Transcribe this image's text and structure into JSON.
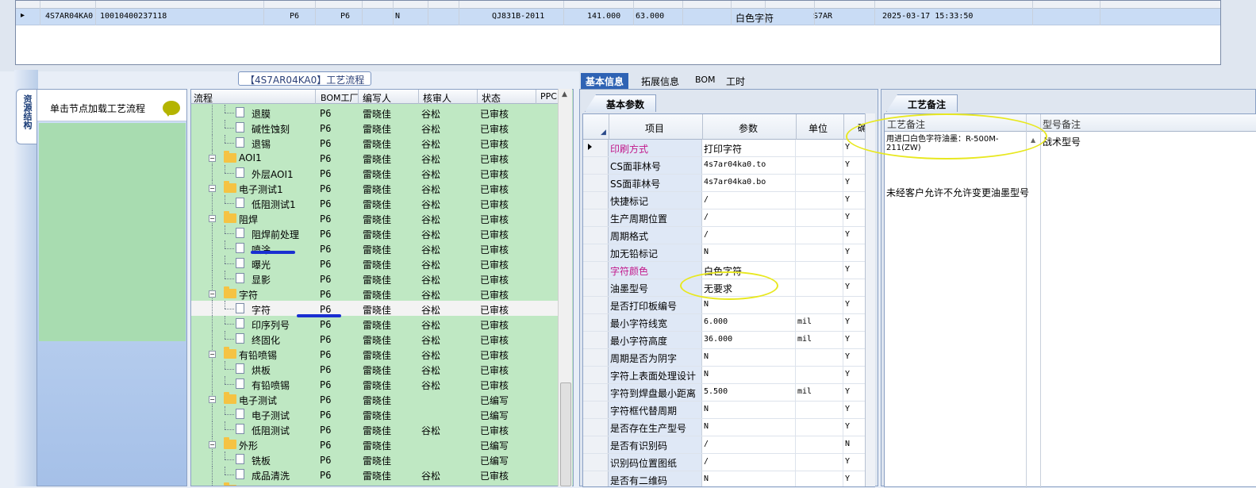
{
  "top_grid": {
    "row": {
      "code": "4S7AR04KA0",
      "id": "10010400237118",
      "f1": "P6",
      "f2": "P6",
      "f3": "N",
      "spec": "QJ831B-2011",
      "v1": "141.000",
      "v2": "63.000",
      "color": "白色字符",
      "model": "S7AR",
      "time": "2025-03-17 15:33:50"
    }
  },
  "side": {
    "tab_label": "资源结构",
    "hint": "单击节点加载工艺流程"
  },
  "tree": {
    "title": "【4S7AR04KA0】工艺流程",
    "headers": [
      "流程",
      "BOM工厂",
      "编写人",
      "核审人",
      "状态",
      "PPC"
    ],
    "rows": [
      {
        "name": "退膜",
        "level": 2,
        "bom": "P6",
        "writer": "雷晓佳",
        "reviewer": "谷松",
        "status": "已审核"
      },
      {
        "name": "碱性蚀刻",
        "level": 2,
        "bom": "P6",
        "writer": "雷晓佳",
        "reviewer": "谷松",
        "status": "已审核"
      },
      {
        "name": "退锡",
        "level": 2,
        "bom": "P6",
        "writer": "雷晓佳",
        "reviewer": "谷松",
        "status": "已审核"
      },
      {
        "name": "AOI1",
        "level": 1,
        "bom": "P6",
        "writer": "雷晓佳",
        "reviewer": "谷松",
        "status": "已审核"
      },
      {
        "name": "外层AOI1",
        "level": 2,
        "bom": "P6",
        "writer": "雷晓佳",
        "reviewer": "谷松",
        "status": "已审核"
      },
      {
        "name": "电子测试1",
        "level": 1,
        "bom": "P6",
        "writer": "雷晓佳",
        "reviewer": "谷松",
        "status": "已审核"
      },
      {
        "name": "低阻测试1",
        "level": 2,
        "bom": "P6",
        "writer": "雷晓佳",
        "reviewer": "谷松",
        "status": "已审核"
      },
      {
        "name": "阻焊",
        "level": 1,
        "bom": "P6",
        "writer": "雷晓佳",
        "reviewer": "谷松",
        "status": "已审核"
      },
      {
        "name": "阻焊前处理",
        "level": 2,
        "bom": "P6",
        "writer": "雷晓佳",
        "reviewer": "谷松",
        "status": "已审核"
      },
      {
        "name": "喷涂",
        "level": 2,
        "bom": "P6",
        "writer": "雷晓佳",
        "reviewer": "谷松",
        "status": "已审核"
      },
      {
        "name": "曝光",
        "level": 2,
        "bom": "P6",
        "writer": "雷晓佳",
        "reviewer": "谷松",
        "status": "已审核"
      },
      {
        "name": "显影",
        "level": 2,
        "bom": "P6",
        "writer": "雷晓佳",
        "reviewer": "谷松",
        "status": "已审核"
      },
      {
        "name": "字符",
        "level": 1,
        "bom": "P6",
        "writer": "雷晓佳",
        "reviewer": "谷松",
        "status": "已审核"
      },
      {
        "name": "字符",
        "level": 2,
        "bom": "P6",
        "writer": "雷晓佳",
        "reviewer": "谷松",
        "status": "已审核",
        "selected": true
      },
      {
        "name": "印序列号",
        "level": 2,
        "bom": "P6",
        "writer": "雷晓佳",
        "reviewer": "谷松",
        "status": "已审核"
      },
      {
        "name": "终固化",
        "level": 2,
        "bom": "P6",
        "writer": "雷晓佳",
        "reviewer": "谷松",
        "status": "已审核"
      },
      {
        "name": "有铅喷锡",
        "level": 1,
        "bom": "P6",
        "writer": "雷晓佳",
        "reviewer": "谷松",
        "status": "已审核"
      },
      {
        "name": "烘板",
        "level": 2,
        "bom": "P6",
        "writer": "雷晓佳",
        "reviewer": "谷松",
        "status": "已审核"
      },
      {
        "name": "有铅喷锡",
        "level": 2,
        "bom": "P6",
        "writer": "雷晓佳",
        "reviewer": "谷松",
        "status": "已审核"
      },
      {
        "name": "电子测试",
        "level": 1,
        "bom": "P6",
        "writer": "雷晓佳",
        "reviewer": "",
        "status": "已编写"
      },
      {
        "name": "电子测试",
        "level": 2,
        "bom": "P6",
        "writer": "雷晓佳",
        "reviewer": "",
        "status": "已编写"
      },
      {
        "name": "低阻测试",
        "level": 2,
        "bom": "P6",
        "writer": "雷晓佳",
        "reviewer": "谷松",
        "status": "已审核"
      },
      {
        "name": "外形",
        "level": 1,
        "bom": "P6",
        "writer": "雷晓佳",
        "reviewer": "",
        "status": "已编写"
      },
      {
        "name": "铣板",
        "level": 2,
        "bom": "P6",
        "writer": "雷晓佳",
        "reviewer": "",
        "status": "已编写"
      },
      {
        "name": "成品清洗",
        "level": 2,
        "bom": "P6",
        "writer": "雷晓佳",
        "reviewer": "谷松",
        "status": "已审核"
      },
      {
        "name": "终检",
        "level": 1,
        "bom": "P6",
        "writer": "雷晓佳",
        "reviewer": "谷松",
        "status": "已审核"
      }
    ]
  },
  "tabs": [
    "基本信息",
    "拓展信息",
    "BOM",
    "工时"
  ],
  "basic": {
    "subtab": "基本参数",
    "headers": [
      "项目",
      "参数",
      "单位",
      "确"
    ],
    "rows": [
      {
        "item": "印刷方式",
        "value": "打印字符",
        "unit": "",
        "flag": "Y",
        "pink": true,
        "cur": true
      },
      {
        "item": "CS面菲林号",
        "value": "4s7ar04ka0.to",
        "unit": "",
        "flag": "Y"
      },
      {
        "item": "SS面菲林号",
        "value": "4s7ar04ka0.bo",
        "unit": "",
        "flag": "Y"
      },
      {
        "item": "快捷标记",
        "value": "/",
        "unit": "",
        "flag": "Y"
      },
      {
        "item": "生产周期位置",
        "value": "/",
        "unit": "",
        "flag": "Y"
      },
      {
        "item": "周期格式",
        "value": "/",
        "unit": "",
        "flag": "Y"
      },
      {
        "item": "加无铅标记",
        "value": "N",
        "unit": "",
        "flag": "Y"
      },
      {
        "item": "字符颜色",
        "value": "白色字符",
        "unit": "",
        "flag": "Y",
        "pink": true
      },
      {
        "item": "油墨型号",
        "value": "无要求",
        "unit": "",
        "flag": "Y"
      },
      {
        "item": "是否打印板编号",
        "value": "N",
        "unit": "",
        "flag": "Y"
      },
      {
        "item": "最小字符线宽",
        "value": "6.000",
        "unit": "mil",
        "flag": "Y"
      },
      {
        "item": "最小字符高度",
        "value": "36.000",
        "unit": "mil",
        "flag": "Y"
      },
      {
        "item": "周期是否为阴字",
        "value": "N",
        "unit": "",
        "flag": "Y"
      },
      {
        "item": "字符上表面处理设计",
        "value": "N",
        "unit": "",
        "flag": "Y"
      },
      {
        "item": "字符到焊盘最小距离",
        "value": "5.500",
        "unit": "mil",
        "flag": "Y"
      },
      {
        "item": "字符框代替周期",
        "value": "N",
        "unit": "",
        "flag": "Y"
      },
      {
        "item": "是否存在生产型号",
        "value": "N",
        "unit": "",
        "flag": "Y"
      },
      {
        "item": "是否有识别码",
        "value": "/",
        "unit": "",
        "flag": "N"
      },
      {
        "item": "识别码位置图纸",
        "value": "/",
        "unit": "",
        "flag": "Y"
      },
      {
        "item": "是否有二维码",
        "value": "N",
        "unit": "",
        "flag": "Y"
      }
    ]
  },
  "notes": {
    "subtab": "工艺备注",
    "col1": "工艺备注",
    "col2": "型号备注",
    "note1": "用进口白色字符油墨：R-500M-211(ZW)",
    "note2": "未经客户允许不允许变更油墨型号",
    "model_note": "战术型号"
  }
}
